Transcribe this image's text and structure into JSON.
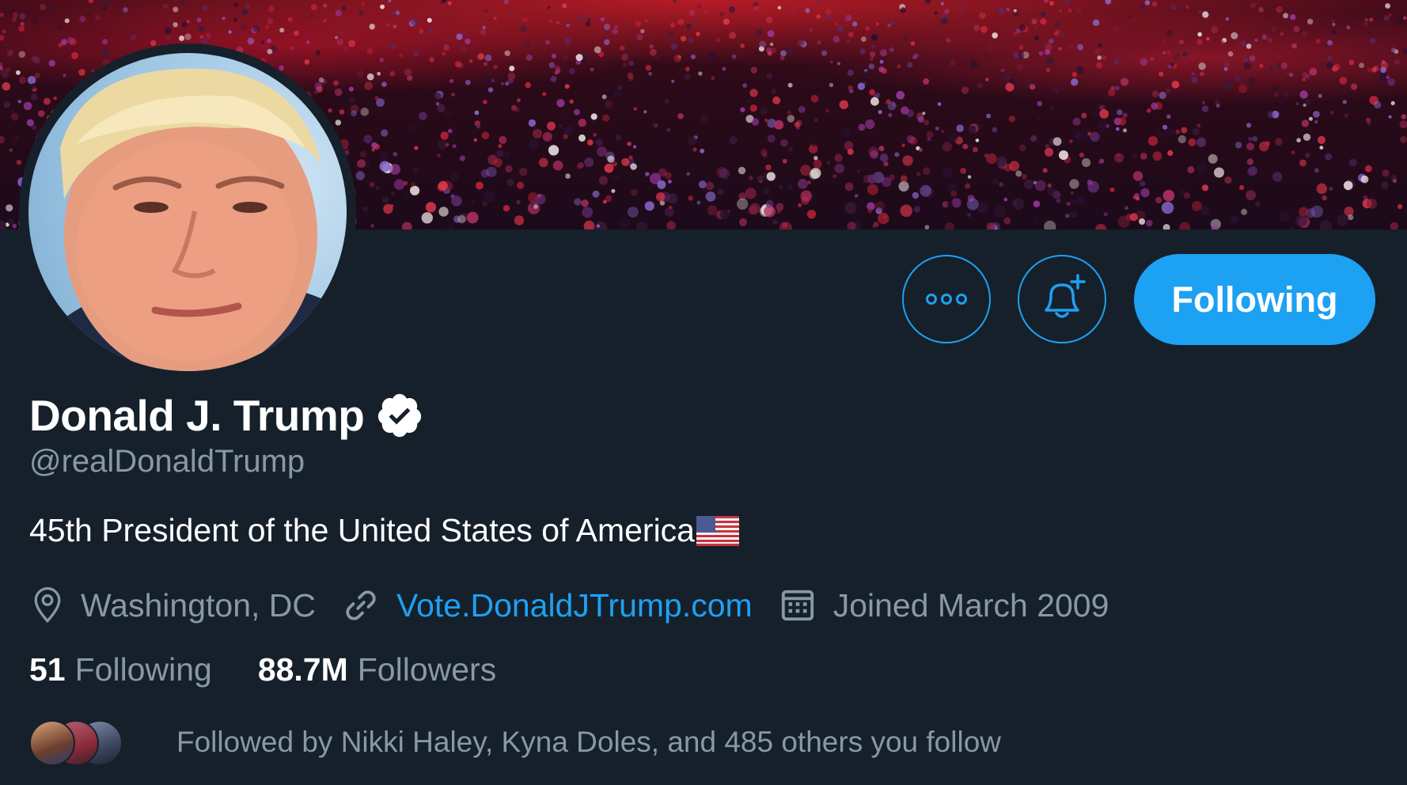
{
  "profile": {
    "name": "Donald J. Trump",
    "handle": "@realDonaldTrump",
    "bio": "45th President of the United States of America",
    "verified": true
  },
  "actions": {
    "more_icon": "more-horizontal-icon",
    "notify_icon": "bell-plus-icon",
    "following_label": "Following"
  },
  "meta": {
    "location": "Washington, DC",
    "website": "Vote.DonaldJTrump.com",
    "joined": "Joined March 2009",
    "location_icon": "location-pin-icon",
    "link_icon": "link-icon",
    "calendar_icon": "calendar-icon",
    "link_color": "#1da1f2"
  },
  "stats": {
    "following_count": "51",
    "following_label": "Following",
    "followers_count": "88.7M",
    "followers_label": "Followers"
  },
  "followed_by": {
    "text": "Followed by Nikki Haley, Kyna Doles, and 485 others you follow"
  },
  "colors": {
    "background": "#15202b",
    "accent": "#1da1f2",
    "secondary_text": "#8899a6",
    "primary_text": "#ffffff"
  }
}
